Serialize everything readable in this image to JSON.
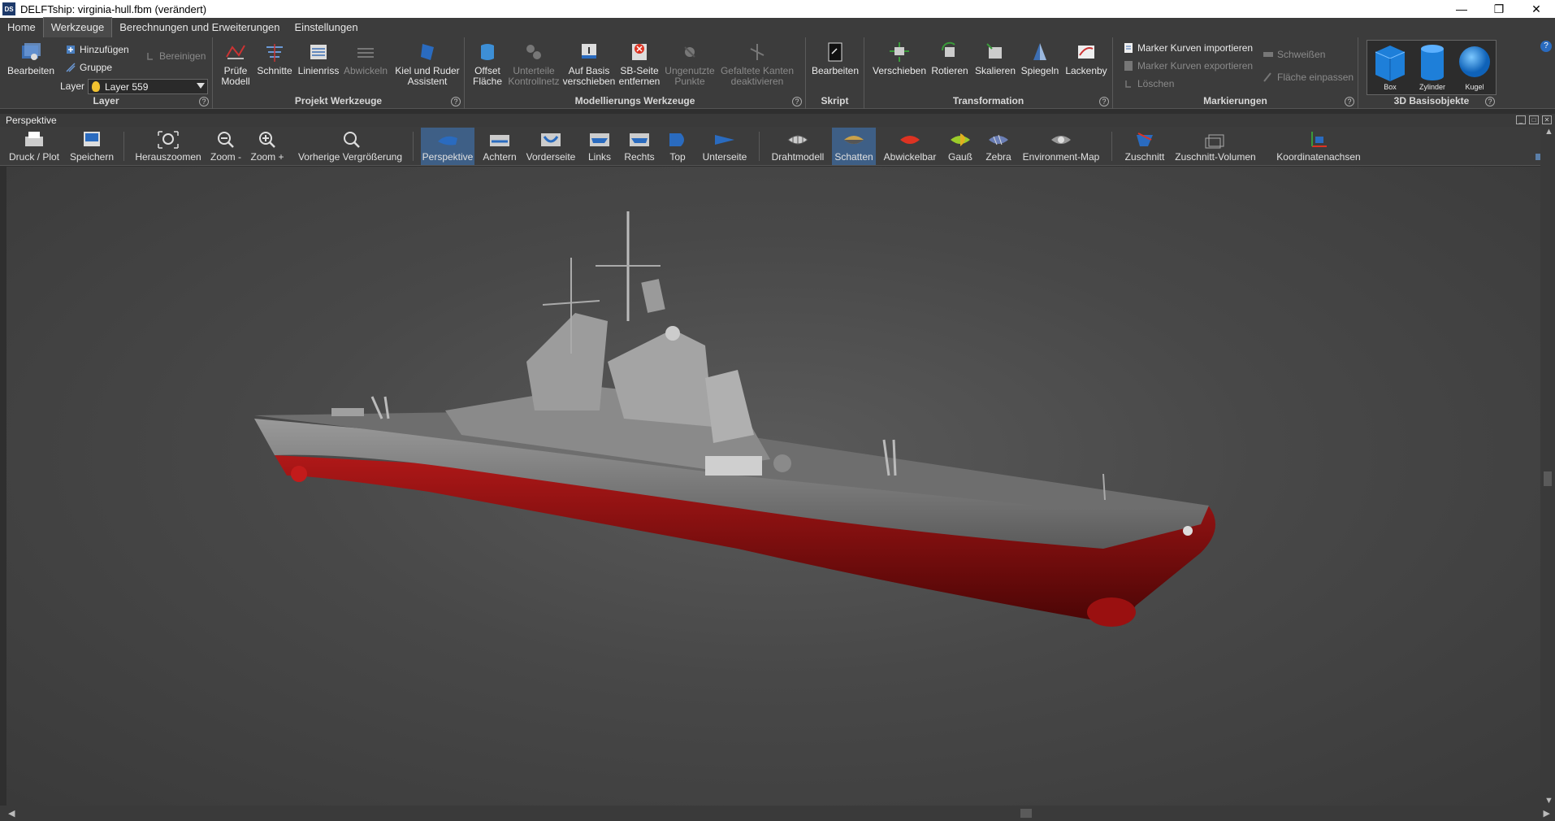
{
  "window": {
    "title": "DELFTship: virginia-hull.fbm (verändert)",
    "app_icon": "DS",
    "minimize": "—",
    "restore": "❐",
    "close": "✕"
  },
  "menu": {
    "tabs": [
      "Home",
      "Werkzeuge",
      "Berechnungen und Erweiterungen",
      "Einstellungen"
    ],
    "active": "Werkzeuge"
  },
  "ribbon": {
    "layer": {
      "label": "Layer",
      "edit": "Bearbeiten",
      "add": "Hinzufügen",
      "group": "Gruppe",
      "clean": "Bereinigen",
      "layer_label": "Layer",
      "layer_value": "Layer 559"
    },
    "project_tools": {
      "label": "Projekt Werkzeuge",
      "check_model": [
        "Prüfe",
        "Modell"
      ],
      "sections": "Schnitte",
      "lines": "Linienriss",
      "develop": "Abwickeln",
      "keel": [
        "Kiel und Ruder",
        "Assistent"
      ]
    },
    "modeling_tools": {
      "label": "Modellierungs Werkzeuge",
      "offset": [
        "Offset",
        "Fläche"
      ],
      "subdivide": [
        "Unterteile",
        "Kontrollnetz"
      ],
      "move_base": [
        "Auf Basis",
        "verschieben"
      ],
      "remove_sb": [
        "SB-Seite",
        "entfernen"
      ],
      "unused": [
        "Ungenutzte",
        "Punkte"
      ],
      "folded": [
        "Gefaltete Kanten",
        "deaktivieren"
      ]
    },
    "script": {
      "label": "Skript",
      "edit": "Bearbeiten"
    },
    "transform": {
      "label": "Transformation",
      "move": "Verschieben",
      "rotate": "Rotieren",
      "scale": "Skalieren",
      "mirror": "Spiegeln",
      "lackenby": "Lackenby"
    },
    "markers": {
      "label": "Markierungen",
      "import": "Marker Kurven importieren",
      "export": "Marker Kurven exportieren",
      "delete": "Löschen",
      "weld": "Schweißen",
      "fit": "Fläche einpassen"
    },
    "primitives": {
      "label": "3D Basisobjekte",
      "box": "Box",
      "cylinder": "Zylinder",
      "sphere": "Kugel"
    },
    "help": "?"
  },
  "viewport": {
    "title": "Perspektive",
    "toolbar": {
      "print": "Druck / Plot",
      "save": "Speichern",
      "zoom_out_all": "Herauszoomen",
      "zoom_minus": "Zoom -",
      "zoom_plus": "Zoom +",
      "prev_zoom": "Vorherige Vergrößerung",
      "perspective": "Perspektive",
      "aft": "Achtern",
      "front": "Vorderseite",
      "left": "Links",
      "right": "Rechts",
      "top": "Top",
      "bottom": "Unterseite",
      "wireframe": "Drahtmodell",
      "shade": "Schatten",
      "developable": "Abwickelbar",
      "gauss": "Gauß",
      "zebra": "Zebra",
      "envmap": "Environment-Map",
      "cut": "Zuschnitt",
      "cut_volume": "Zuschnitt-Volumen",
      "axes": "Koordinatenachsen"
    },
    "active_view": "Perspektive",
    "active_mode": "Schatten"
  },
  "colors": {
    "accent": "#3e5f86",
    "hull_red": "#8b0e0e",
    "hull_grey": "#7a7a7a",
    "background": "#3c3c3c"
  }
}
